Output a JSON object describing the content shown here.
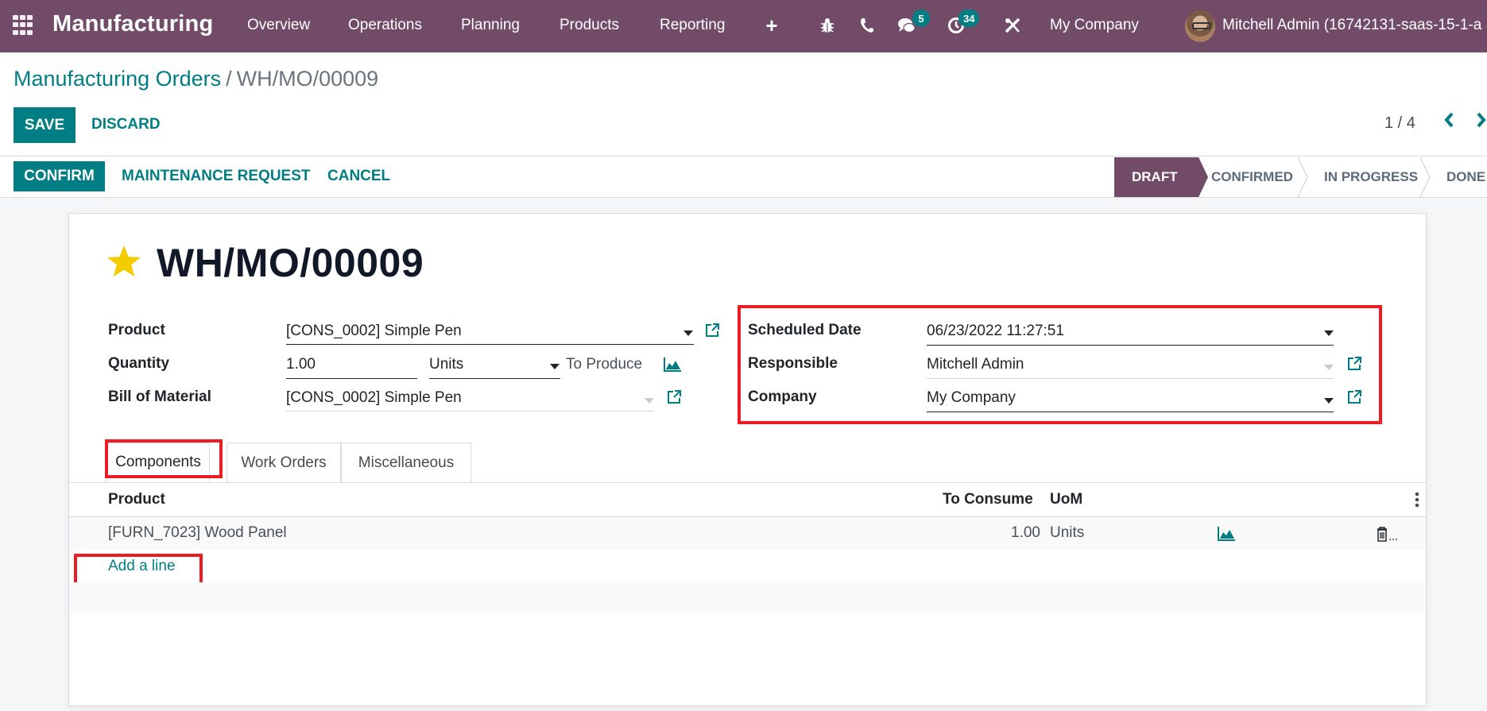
{
  "navbar": {
    "app_name": "Manufacturing",
    "menu": [
      "Overview",
      "Operations",
      "Planning",
      "Products",
      "Reporting"
    ],
    "icons": [
      "apps-icon",
      "plus-icon",
      "bug-icon",
      "phone-icon",
      "chat-icon",
      "activity-clock-icon",
      "tools-icon"
    ],
    "messages_badge": "5",
    "activities_badge": "34",
    "company": "My Company",
    "user": "Mitchell Admin (16742131-saas-15-1-a"
  },
  "breadcrumb": {
    "parent": "Manufacturing Orders",
    "separator": "/",
    "current": "WH/MO/00009"
  },
  "toolbar": {
    "save_label": "SAVE",
    "discard_label": "DISCARD",
    "pager": "1 / 4"
  },
  "actions": {
    "confirm_label": "CONFIRM",
    "maintenance_label": "MAINTENANCE REQUEST",
    "cancel_label": "CANCEL"
  },
  "statusbar": {
    "steps": [
      "DRAFT",
      "CONFIRMED",
      "IN PROGRESS",
      "DONE"
    ],
    "active": "DRAFT"
  },
  "record": {
    "title": "WH/MO/00009",
    "starred": true,
    "left_fields": {
      "product_label": "Product",
      "product_value": "[CONS_0002] Simple Pen",
      "quantity_label": "Quantity",
      "quantity_value": "1.00",
      "uom_value": "Units",
      "to_produce": "To Produce",
      "bom_label": "Bill of Material",
      "bom_value": "[CONS_0002] Simple Pen"
    },
    "right_fields": {
      "scheduled_label": "Scheduled Date",
      "scheduled_value": "06/23/2022 11:27:51",
      "responsible_label": "Responsible",
      "responsible_value": "Mitchell Admin",
      "company_label": "Company",
      "company_value": "My Company"
    }
  },
  "tabs": [
    {
      "label": "Components",
      "active": true
    },
    {
      "label": "Work Orders",
      "active": false
    },
    {
      "label": "Miscellaneous",
      "active": false
    }
  ],
  "components_table": {
    "columns": [
      "Product",
      "To Consume",
      "UoM"
    ],
    "rows": [
      {
        "product": "[FURN_7023] Wood Panel",
        "to_consume": "1.00",
        "uom": "Units"
      }
    ],
    "add_line": "Add a line"
  },
  "colors": {
    "brand": "#714B67",
    "accent": "#017E84",
    "highlight": "#EC1C24",
    "star": "#F3CC00"
  }
}
